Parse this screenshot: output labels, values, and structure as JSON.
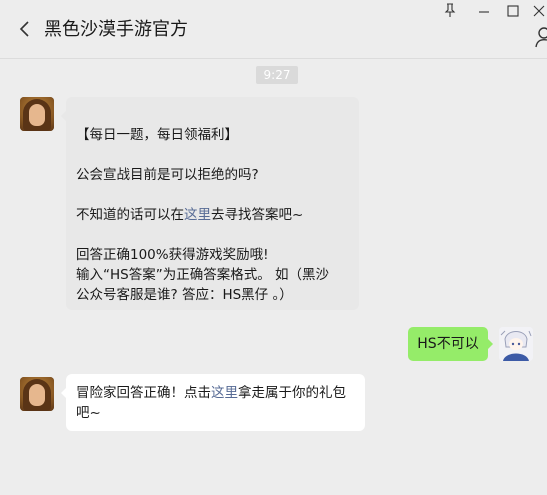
{
  "chat_title": "黑色沙漠手游官方",
  "time_label": "9:27",
  "messages": {
    "m1": {
      "line1": "【每日一题，每日领福利】",
      "line2": "公会宣战目前是可以拒绝的吗?",
      "line3_pre": "不知道的话可以在",
      "line3_link": "这里",
      "line3_post": "去寻找答案吧~",
      "line4": "回答正确100%获得游戏奖励哦!",
      "line5": "输入“HS答案”为正确答案格式。 如（黑沙",
      "line6": "公众号客服是谁? 答应：HS黑仔 。）"
    },
    "m2": {
      "text": "HS不可以"
    },
    "m3": {
      "line1_pre": "冒险家回答正确！点击",
      "line1_link": "这里",
      "line1_post": "拿走属于你的礼包",
      "line2": "吧~"
    }
  }
}
